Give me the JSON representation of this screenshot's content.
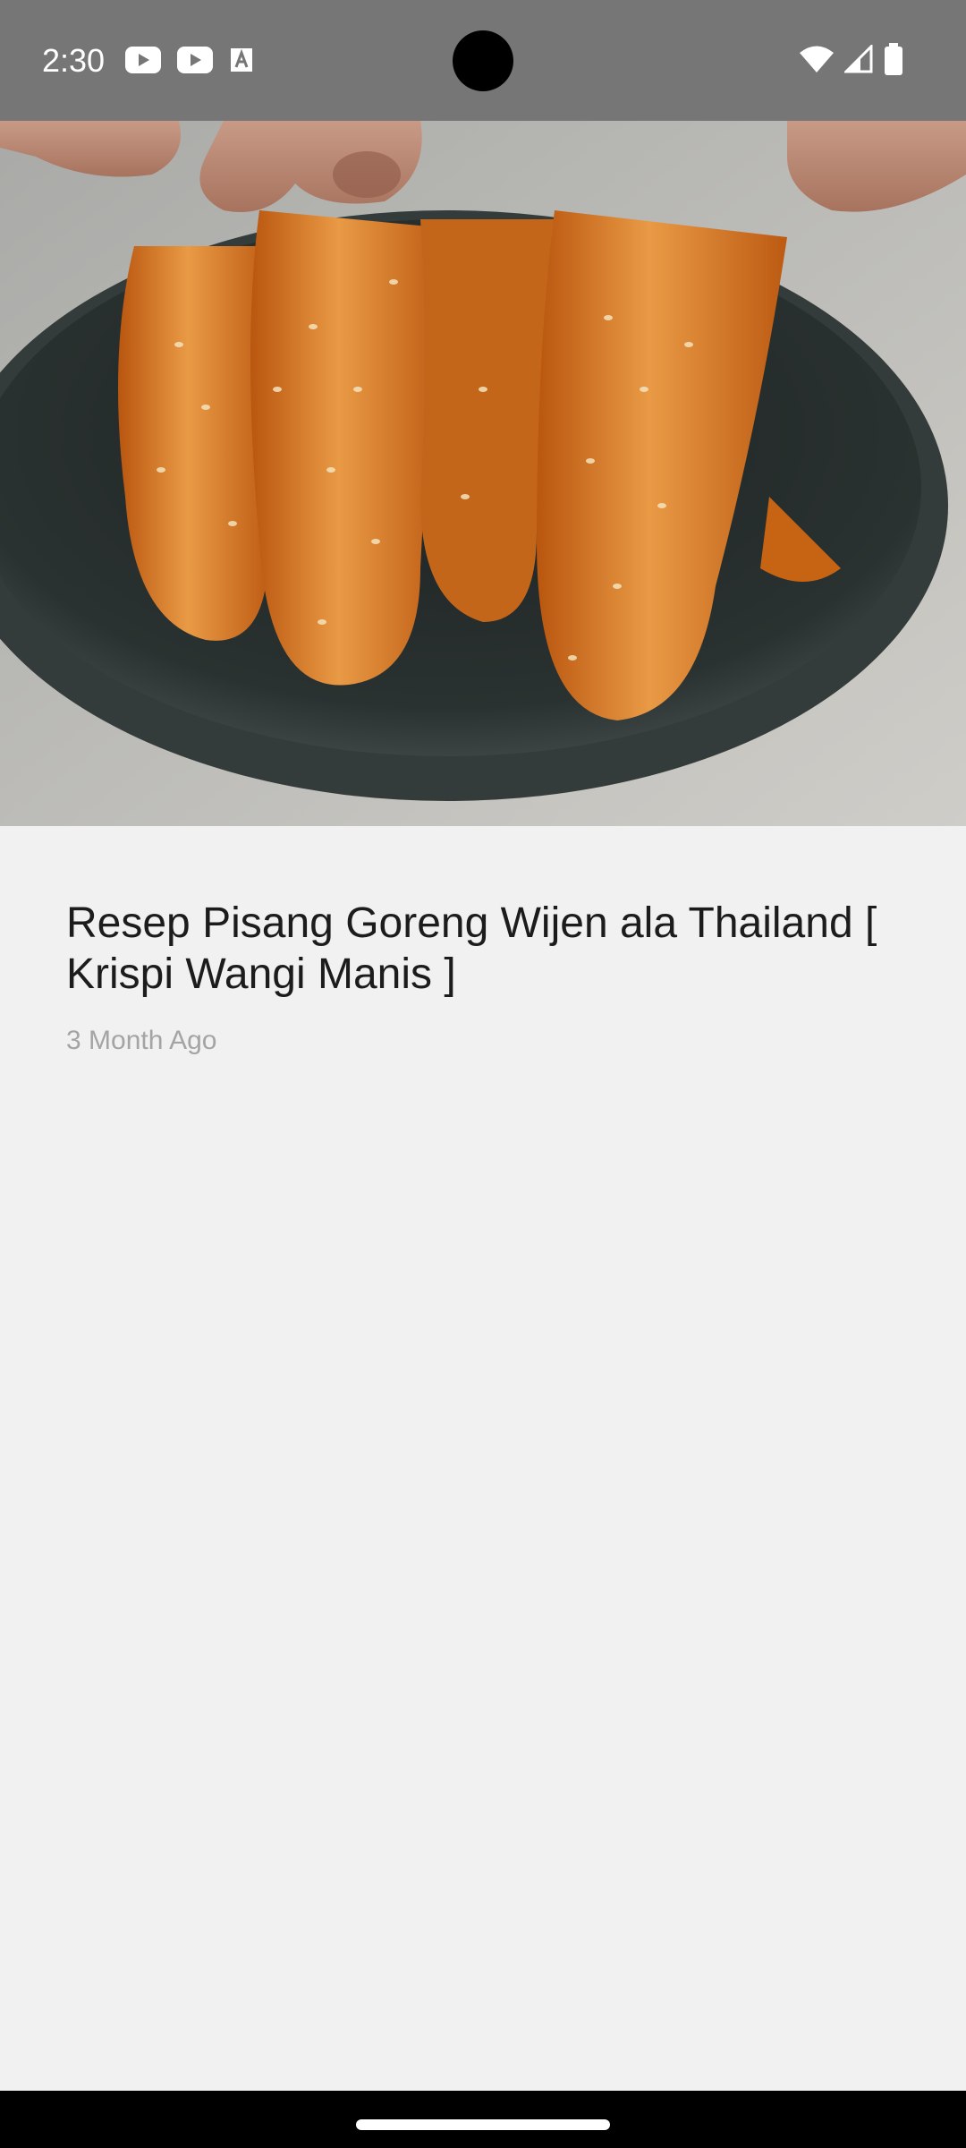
{
  "status_bar": {
    "time": "2:30",
    "notification_icons": [
      "youtube-icon",
      "youtube-icon",
      "text-a-icon"
    ],
    "system_icons": [
      "wifi-icon",
      "cellular-signal-icon",
      "battery-icon"
    ],
    "background_color": "#767676"
  },
  "article": {
    "image_subject": "fried-banana-sesame-photo",
    "title": "Resep Pisang Goreng Wijen ala Thailand [ Krispi Wangi Manis ]",
    "date": "3 Month Ago"
  },
  "nav_bar": {
    "indicator": "home-indicator"
  },
  "colors": {
    "page_background": "#f1f1f1",
    "title_text": "#1c1c1c",
    "date_text": "#a4a4a4"
  }
}
